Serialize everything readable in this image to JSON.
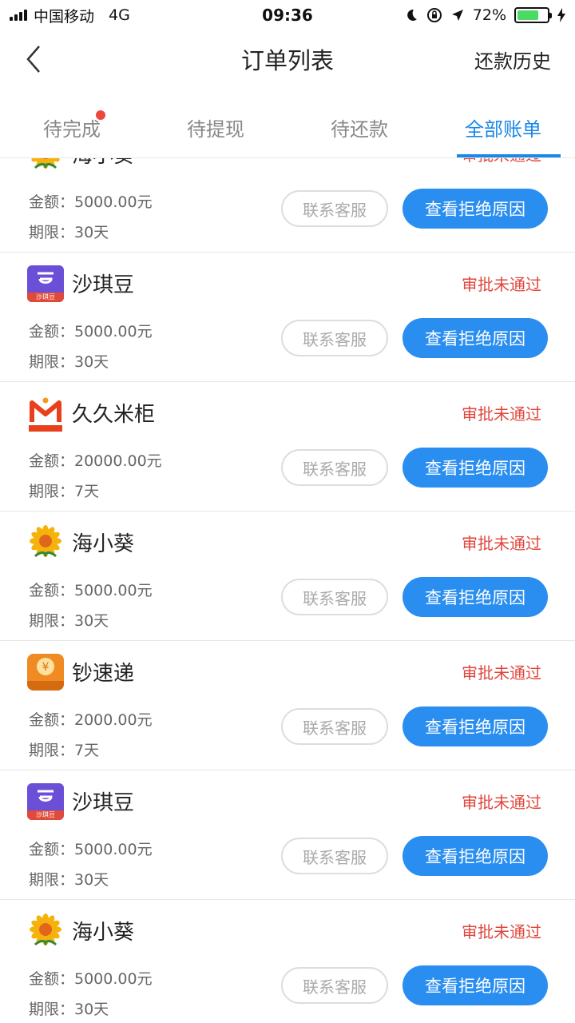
{
  "status_bar": {
    "carrier": "中国移动",
    "network": "4G",
    "time": "09:36",
    "battery": "72%",
    "battery_level": 0.72
  },
  "nav": {
    "title": "订单列表",
    "right_label": "还款历史"
  },
  "tabs": [
    {
      "label": "待完成",
      "badge": true
    },
    {
      "label": "待提现",
      "badge": false
    },
    {
      "label": "待还款",
      "badge": false
    },
    {
      "label": "全部账单",
      "badge": false,
      "active": true
    }
  ],
  "orders": [
    {
      "name": "海小葵",
      "status": "审批未通过",
      "amount": "金额：5000.00元",
      "term": "期限：30天",
      "contact": "联系客服",
      "action": "查看拒绝原因",
      "logo": "sunflower-logo"
    },
    {
      "name": "沙琪豆",
      "status": "审批未通过",
      "amount": "金额：5000.00元",
      "term": "期限：30天",
      "contact": "联系客服",
      "action": "查看拒绝原因",
      "logo": "shaqidou-logo",
      "logo_sub": "沙琪豆"
    },
    {
      "name": "久久米柜",
      "status": "审批未通过",
      "amount": "金额：20000.00元",
      "term": "期限：7天",
      "contact": "联系客服",
      "action": "查看拒绝原因",
      "logo": "jiujiu-logo"
    },
    {
      "name": "海小葵",
      "status": "审批未通过",
      "amount": "金额：5000.00元",
      "term": "期限：30天",
      "contact": "联系客服",
      "action": "查看拒绝原因",
      "logo": "sunflower-logo"
    },
    {
      "name": "钞速递",
      "status": "审批未通过",
      "amount": "金额：2000.00元",
      "term": "期限：7天",
      "contact": "联系客服",
      "action": "查看拒绝原因",
      "logo": "chaosudi-logo"
    },
    {
      "name": "沙琪豆",
      "status": "审批未通过",
      "amount": "金额：5000.00元",
      "term": "期限：30天",
      "contact": "联系客服",
      "action": "查看拒绝原因",
      "logo": "shaqidou-logo",
      "logo_sub": "沙琪豆"
    },
    {
      "name": "海小葵",
      "status": "审批未通过",
      "amount": "金额：5000.00元",
      "term": "期限：30天",
      "contact": "联系客服",
      "action": "查看拒绝原因",
      "logo": "sunflower-logo"
    }
  ],
  "colors": {
    "accent": "#2a8ef0",
    "status_red": "#e0463c",
    "badge": "#f0463c"
  }
}
